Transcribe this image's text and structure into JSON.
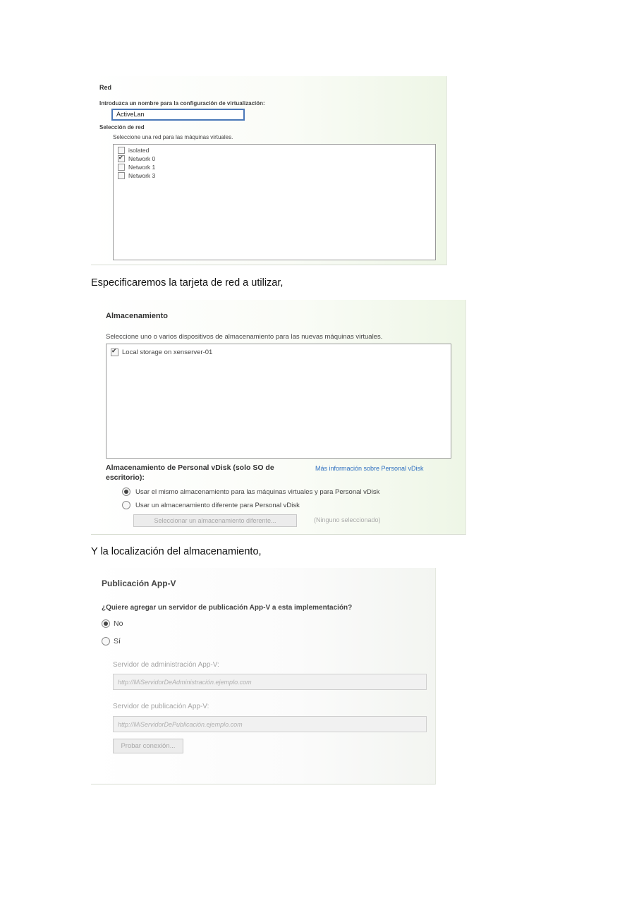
{
  "captions": {
    "network_caption": "Especificaremos la tarjeta de red a utilizar,",
    "storage_caption": "Y la localización del almacenamiento,"
  },
  "network_panel": {
    "heading": "Red",
    "name_label": "Introduzca un nombre para la configuración de virtualización:",
    "name_value": "ActiveLan",
    "selection_heading": "Selección de red",
    "selection_hint": "Seleccione una red para las máquinas virtuales.",
    "networks": [
      {
        "label": "isolated",
        "checked": false
      },
      {
        "label": "Network 0",
        "checked": true
      },
      {
        "label": "Network 1",
        "checked": false
      },
      {
        "label": "Network 3",
        "checked": false
      }
    ]
  },
  "storage_panel": {
    "heading": "Almacenamiento",
    "hint": "Seleccione uno o varios dispositivos de almacenamiento para las nuevas máquinas virtuales.",
    "devices": [
      {
        "label": "Local storage on xenserver-01",
        "checked": true
      }
    ],
    "pvd_heading_line1": "Almacenamiento de Personal vDisk (solo SO de",
    "pvd_heading_line2": "escritorio):",
    "pvd_link": "Más información sobre Personal vDisk",
    "radio_same": "Usar el mismo almacenamiento para las máquinas virtuales y para Personal vDisk",
    "radio_different": "Usar un almacenamiento diferente para Personal vDisk",
    "selected_option": "same",
    "select_button": "Seleccionar un almacenamiento diferente...",
    "none_selected": "(Ninguno seleccionado)"
  },
  "appv_panel": {
    "heading": "Publicación App-V",
    "question": "¿Quiere agregar un servidor de publicación App-V a esta implementación?",
    "option_no": "No",
    "option_yes": "Sí",
    "selected_option": "no",
    "admin_server_label": "Servidor de administración App-V:",
    "admin_server_placeholder": "http://MiServidorDeAdministración.ejemplo.com",
    "publishing_server_label": "Servidor de publicación App-V:",
    "publishing_server_placeholder": "http://MiServidorDePublicación.ejemplo.com",
    "test_button": "Probar conexión..."
  }
}
